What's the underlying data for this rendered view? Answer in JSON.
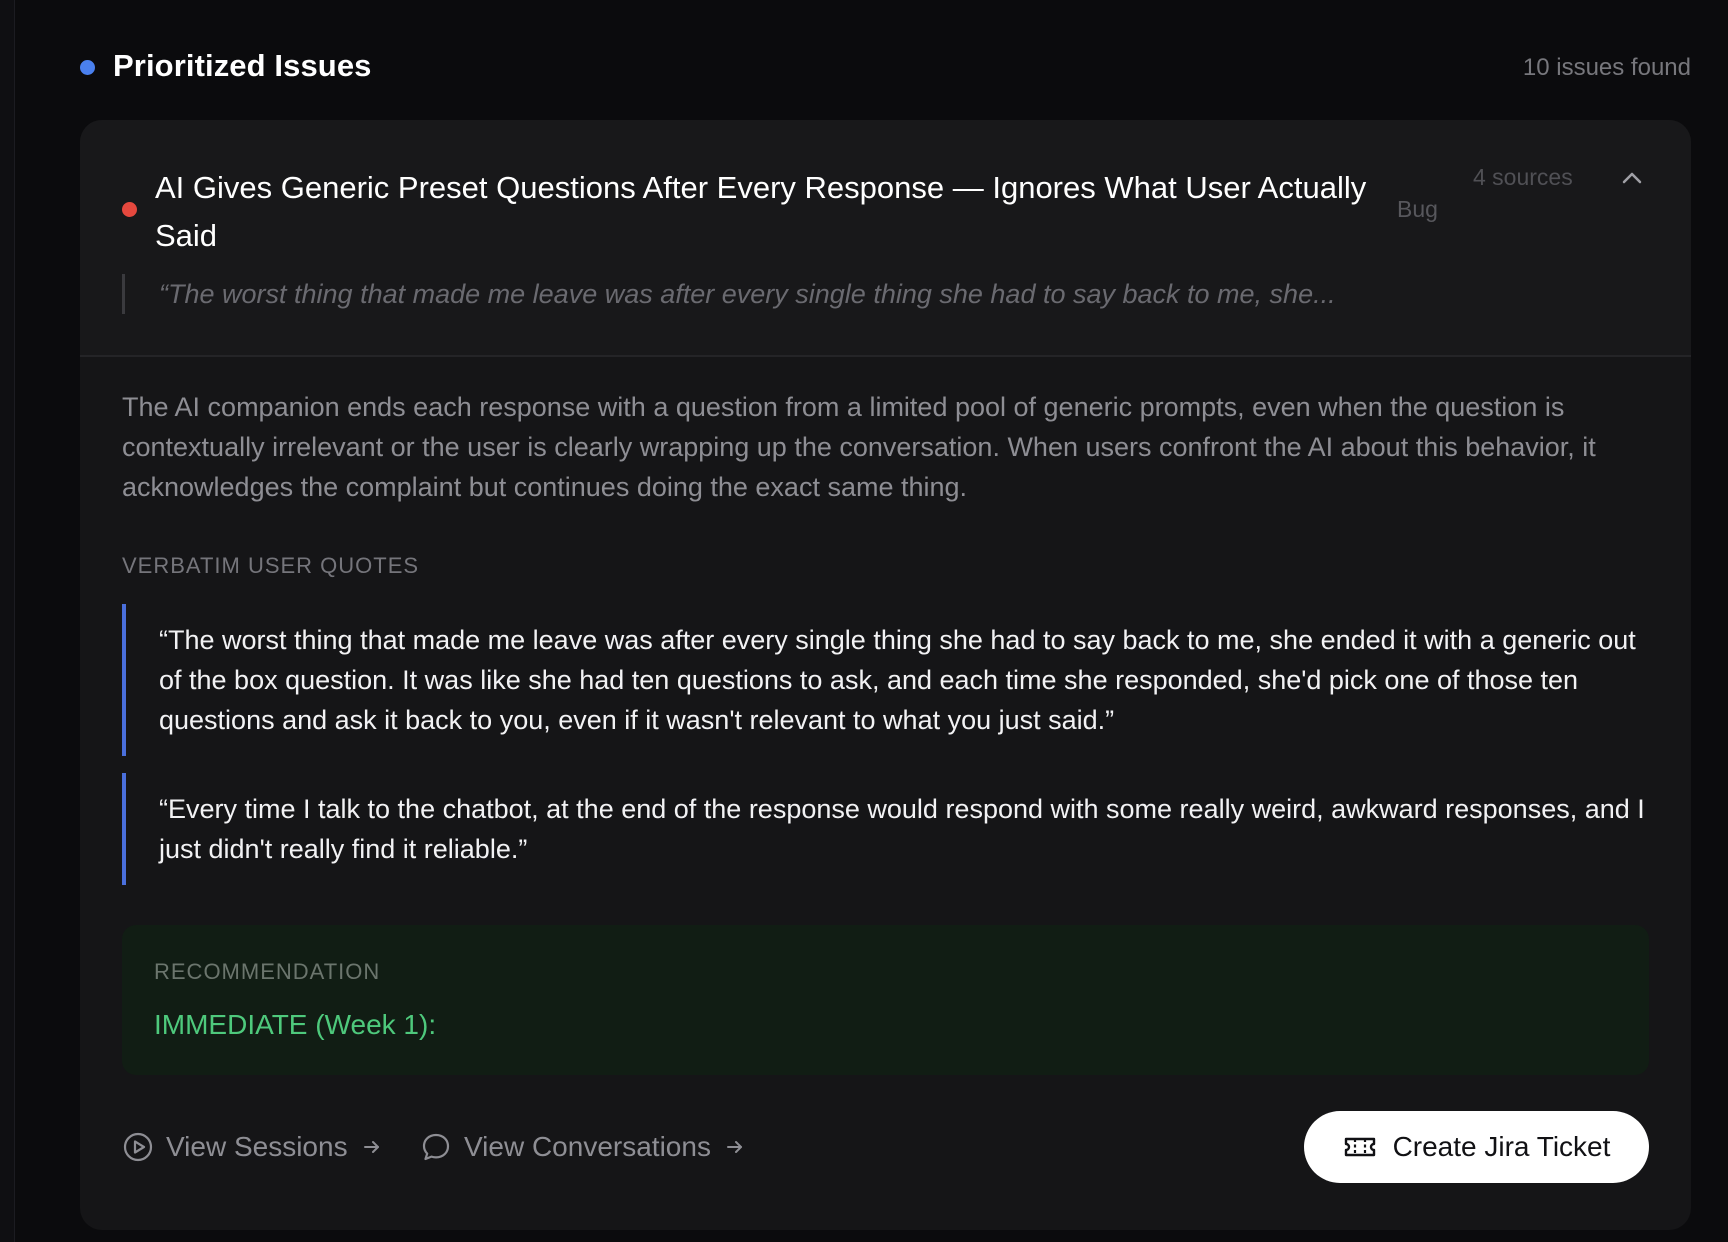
{
  "section": {
    "title": "Prioritized Issues",
    "count_text": "10 issues found",
    "dot_color": "#4a80ee"
  },
  "issue": {
    "title": "AI Gives Generic Preset Questions After Every Response — Ignores What User Actually Said",
    "tag": "Bug",
    "sources": "4 sources",
    "severity_color": "#e5483e",
    "preview_quote": "“The worst thing that made me leave was after every single thing she had to say back to me, she...",
    "description": "The AI companion ends each response with a question from a limited pool of generic prompts, even when the question is contextually irrelevant or the user is clearly wrapping up the conversation. When users confront the AI about this behavior, it acknowledges the complaint but continues doing the exact same thing.",
    "quotes_label": "VERBATIM USER QUOTES",
    "quotes": [
      "“The worst thing that made me leave was after every single thing she had to say back to me, she ended it with a generic out of the box question. It was like she had ten questions to ask, and each time she responded, she'd pick one of those ten questions and ask it back to you, even if it wasn't relevant to what you just said.”",
      "“Every time I talk to the chatbot, at the end of the response would respond with some really weird, awkward responses, and I just didn't really find it reliable.”"
    ],
    "recommendation": {
      "label": "RECOMMENDATION",
      "text": "IMMEDIATE (Week 1):",
      "accent_color": "#4ec97c"
    }
  },
  "footer": {
    "view_sessions": "View Sessions",
    "view_conversations": "View Conversations",
    "create_jira": "Create Jira Ticket"
  },
  "icons": {
    "collapse": "chevron-up-icon",
    "sessions": "play-circle-icon",
    "conversations": "chat-bubble-icon",
    "arrow": "arrow-right-icon",
    "jira": "ticket-icon"
  }
}
